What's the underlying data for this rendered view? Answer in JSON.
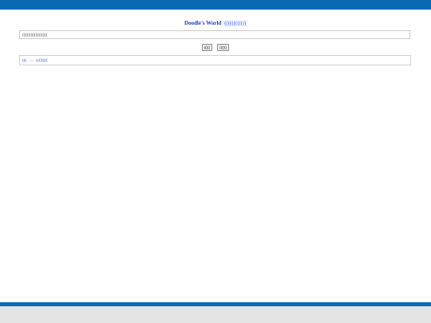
{
  "header": {
    "brand": "Doodle's World",
    "tagline": "(((((((((((("
  },
  "search": {
    "value": "((((((((((((((((((((("
  },
  "buttons": {
    "search_label": "(((((",
    "lucky_label": "(((((("
  },
  "links": {
    "first": "(((",
    "separator": "::::",
    "second": "(((((((("
  },
  "colors": {
    "top_bar": "#0b6ab4",
    "link": "#2d4fd6",
    "footer": "#e4e4e4"
  }
}
